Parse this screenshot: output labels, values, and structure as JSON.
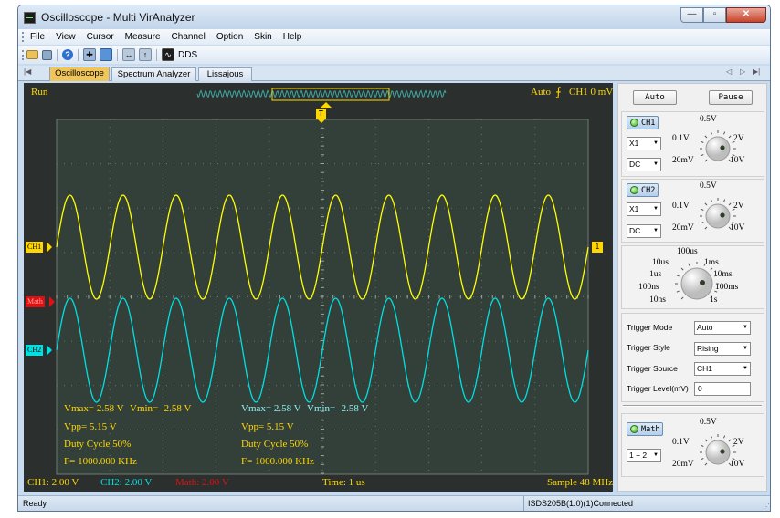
{
  "window": {
    "title": "Oscilloscope - Multi VirAnalyzer",
    "minimize": "—",
    "maximize": "▫",
    "close": "✕"
  },
  "menu": {
    "items": [
      "File",
      "View",
      "Cursor",
      "Measure",
      "Channel",
      "Option",
      "Skin",
      "Help"
    ]
  },
  "toolbar": {
    "icons": [
      "open-folder-icon",
      "save-icon",
      "help-icon",
      "grid-icon",
      "screenshot-icon",
      "zoom-out-icon",
      "zoom-in-icon",
      "dds-icon"
    ],
    "dds_label": "DDS"
  },
  "tabs": {
    "items": [
      "Oscilloscope",
      "Spectrum Analyzer",
      "Lissajous"
    ],
    "active": "Oscilloscope"
  },
  "scope": {
    "run_state": "Run",
    "trigger_mode": "Auto",
    "trigger_status": "CH1 0 mV",
    "trigger_marker": "T",
    "ch1_label": "CH1",
    "ch2_label": "CH2",
    "math_label": "Math",
    "ch1_right_marker": "1",
    "ch1_color": "#ffff00",
    "ch2_color": "#00e0e0",
    "math_color": "#dd1111",
    "grid_color": "#6a7870",
    "measure_ch1": {
      "vmax": "Vmax= 2.58 V",
      "vmin": "Vmin= -2.58 V",
      "vpp": "Vpp= 5.15 V",
      "duty": "Duty Cycle 50%",
      "freq": "F= 1000.000 KHz"
    },
    "measure_ch2": {
      "vmax": "Vmax= 2.58 V",
      "vmin": "Vmin= -2.58 V",
      "vpp": "Vpp= 5.15 V",
      "duty": "Duty Cycle 50%",
      "freq": "F= 1000.000 KHz"
    },
    "footer": {
      "ch1": "CH1: 2.00 V",
      "ch2": "CH2: 2.00 V",
      "math": "Math: 2.00 V",
      "time": "Time: 1 us",
      "sample": "Sample 48 MHz"
    },
    "footer_ch1_color": "#ffd700",
    "footer_ch2_color": "#00e0e0",
    "footer_math_color": "#dd1111",
    "readout_color": "#ffd700",
    "readout_ch2_color": "#8ff0f0",
    "cycles_on_screen": 10
  },
  "controls": {
    "auto_button": "Auto",
    "pause_button": "Pause",
    "ch1": {
      "button": "CH1",
      "probe": "X1",
      "coupling": "DC",
      "knob_labels": {
        "top": "0.5V",
        "left": "0.1V",
        "right": "2V",
        "bottom_left": "20mV",
        "bottom_right": "10V"
      }
    },
    "ch2": {
      "button": "CH2",
      "probe": "X1",
      "coupling": "DC",
      "knob_labels": {
        "top": "0.5V",
        "left": "0.1V",
        "right": "2V",
        "bottom_left": "20mV",
        "bottom_right": "10V"
      }
    },
    "timebase": {
      "labels": {
        "top": "100us",
        "tl": "10us",
        "tr": "1ms",
        "l": "1us",
        "r": "10ms",
        "bl": "100ns",
        "br": "100ms",
        "bbl": "10ns",
        "bbr": "1s"
      }
    },
    "trigger": {
      "mode_label": "Trigger Mode",
      "mode_value": "Auto",
      "style_label": "Trigger Style",
      "style_value": "Rising",
      "source_label": "Trigger Source",
      "source_value": "CH1",
      "level_label": "Trigger Level(mV)",
      "level_value": "0"
    },
    "math": {
      "button": "Math",
      "op": "1 + 2",
      "knob_labels": {
        "top": "0.5V",
        "left": "0.1V",
        "right": "2V",
        "bottom_left": "20mV",
        "bottom_right": "10V"
      }
    }
  },
  "status": {
    "left": "Ready",
    "right": "ISDS205B(1.0)(1)Connected"
  }
}
